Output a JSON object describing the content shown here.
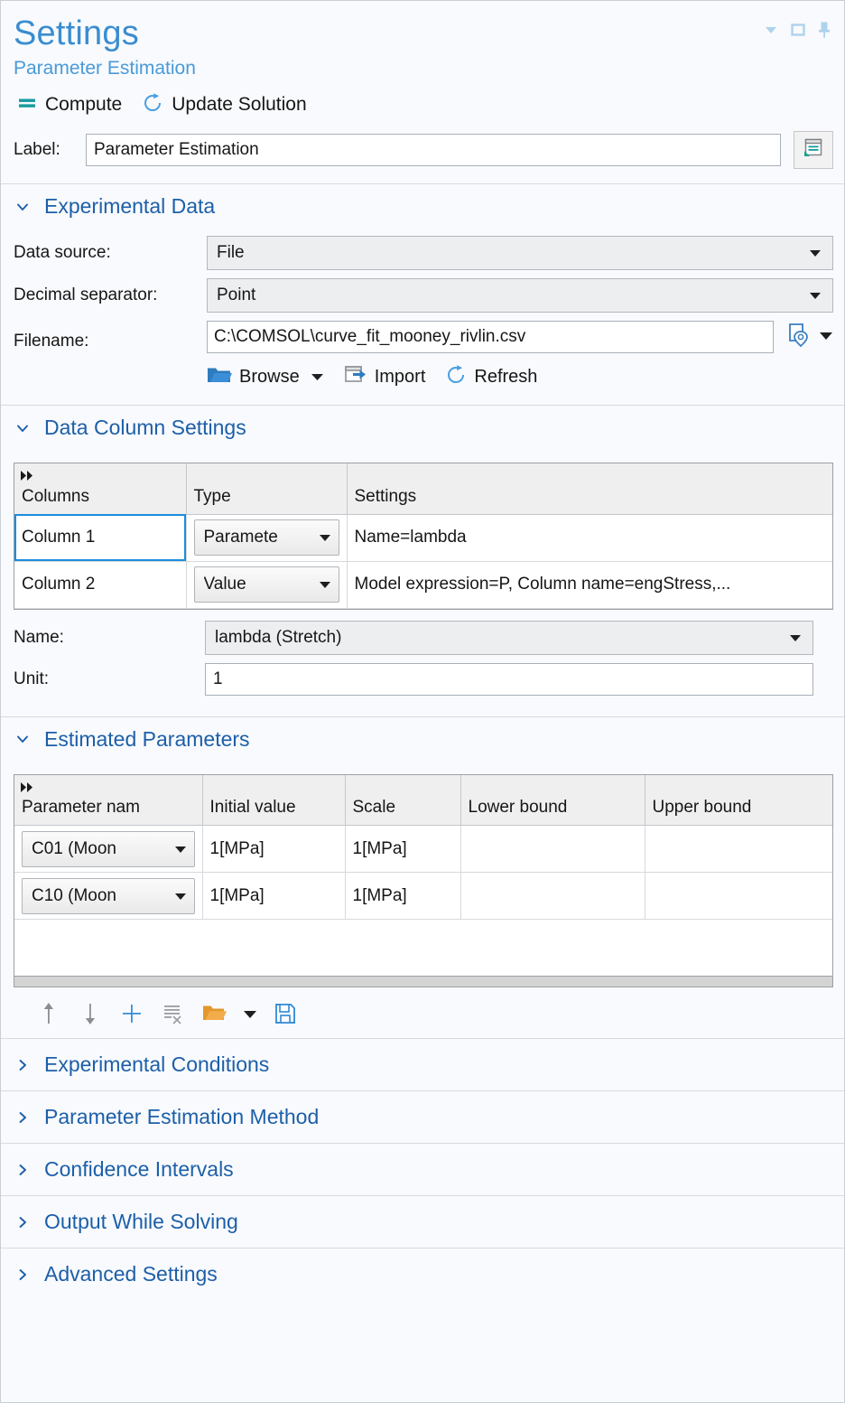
{
  "window": {
    "title": "Settings",
    "subtitle": "Parameter Estimation",
    "icons": [
      "chevron-down-icon",
      "maximize-icon",
      "pin-icon"
    ]
  },
  "toolbar": {
    "compute_label": "Compute",
    "update_solution_label": "Update Solution"
  },
  "label_row": {
    "label": "Label:",
    "value": "Parameter Estimation"
  },
  "experimental_data": {
    "title": "Experimental Data",
    "data_source_label": "Data source:",
    "data_source_value": "File",
    "decimal_separator_label": "Decimal separator:",
    "decimal_separator_value": "Point",
    "filename_label": "Filename:",
    "filename_value": "C:\\COMSOL\\curve_fit_mooney_rivlin.csv",
    "browse_label": "Browse",
    "import_label": "Import",
    "refresh_label": "Refresh"
  },
  "data_column_settings": {
    "title": "Data Column Settings",
    "headers": [
      "Columns",
      "Type",
      "Settings"
    ],
    "rows": [
      {
        "column": "Column 1",
        "type": "Paramete",
        "settings": "Name=lambda",
        "selected": true
      },
      {
        "column": "Column 2",
        "type": "Value",
        "settings": "Model expression=P, Column name=engStress,...",
        "selected": false
      }
    ],
    "name_label": "Name:",
    "name_value": "lambda (Stretch)",
    "unit_label": "Unit:",
    "unit_value": "1"
  },
  "estimated_parameters": {
    "title": "Estimated Parameters",
    "headers": [
      "Parameter nam",
      "Initial value",
      "Scale",
      "Lower bound",
      "Upper bound"
    ],
    "rows": [
      {
        "name": "C01 (Moon",
        "initial_value": "1[MPa]",
        "scale": "1[MPa]",
        "lower_bound": "",
        "upper_bound": ""
      },
      {
        "name": "C10 (Moon",
        "initial_value": "1[MPa]",
        "scale": "1[MPa]",
        "lower_bound": "",
        "upper_bound": ""
      }
    ],
    "tools": [
      "move-up-icon",
      "move-down-icon",
      "add-icon",
      "clear-list-icon",
      "load-from-file-icon",
      "load-dropdown-icon",
      "save-to-file-icon"
    ]
  },
  "collapsed_sections": [
    {
      "title": "Experimental Conditions"
    },
    {
      "title": "Parameter Estimation Method"
    },
    {
      "title": "Confidence Intervals"
    },
    {
      "title": "Output While Solving"
    },
    {
      "title": "Advanced Settings"
    }
  ],
  "colors": {
    "title_blue": "#3a8dd0",
    "section_blue": "#1d5fa8",
    "accent_teal": "#159b9b",
    "icon_blue": "#3a7ebf",
    "folder_orange": "#f0a136",
    "selection_fill": "#cfe7f7",
    "selection_border": "#1b8ddd"
  }
}
